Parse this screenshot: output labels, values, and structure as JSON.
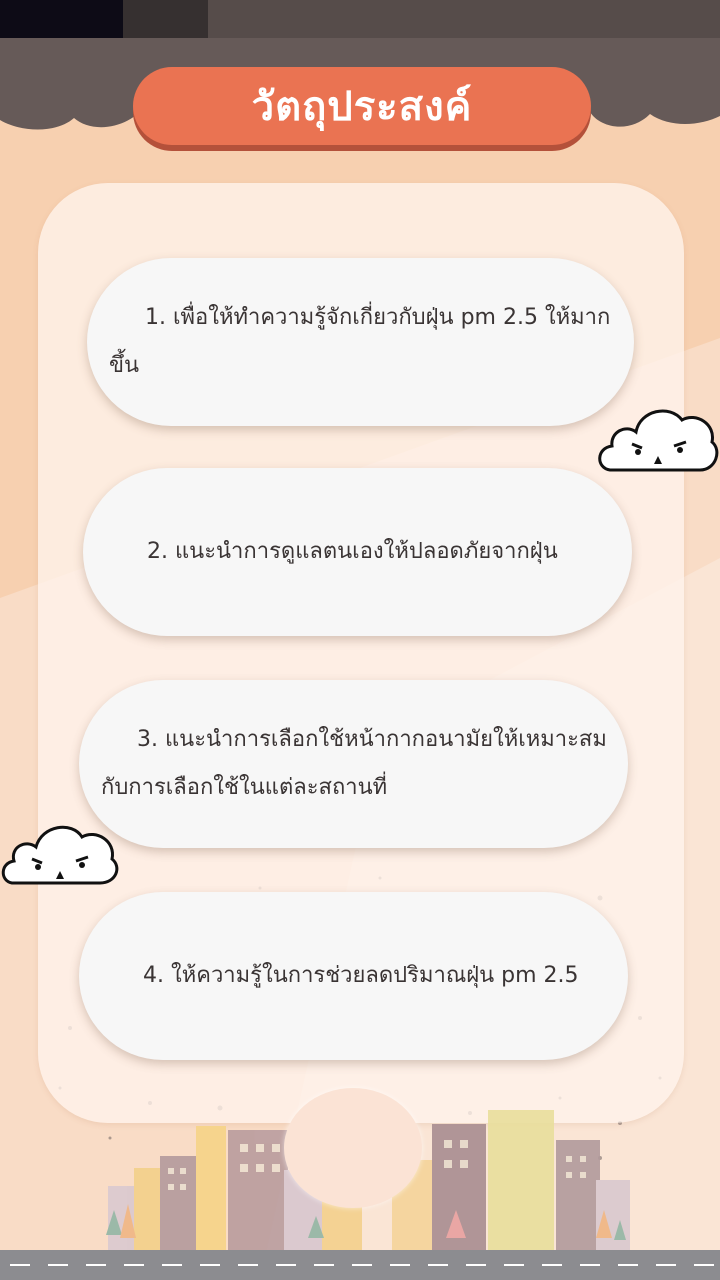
{
  "header": {
    "title": "วัตถุประสงค์"
  },
  "objectives": [
    {
      "text": "1. เพื่อให้ทำความรู้จักเกี่ยวกับฝุ่น pm 2.5 ให้มากขึ้น"
    },
    {
      "text": "2. แนะนำการดูแลตนเองให้ปลอดภัยจากฝุ่น"
    },
    {
      "text": "3. แนะนำการเลือกใช้หน้ากากอนามัยให้เหมาะสมกับการเลือกใช้ในแต่ละสถานที่"
    },
    {
      "text": "4. ให้ความรู้ในการช่วยลดปริมาณฝุ่น pm 2.5"
    }
  ],
  "colors": {
    "background": "#f7d0b0",
    "title_pill": "#ea7352",
    "header_cloud": "#665a58",
    "item_text": "#3a3434"
  },
  "icons": [
    "angry-cloud-icon",
    "city-skyline"
  ]
}
